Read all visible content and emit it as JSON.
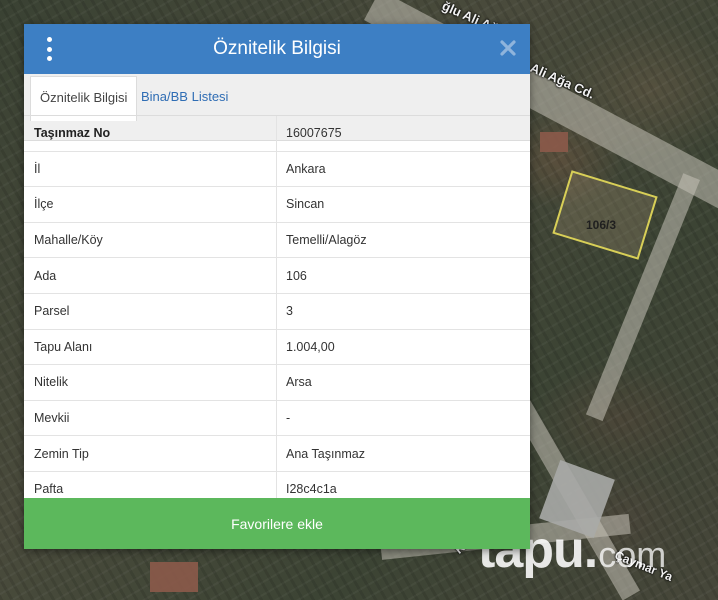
{
  "dialog": {
    "title": "Öznitelik Bilgisi",
    "tabs": [
      {
        "label": "Öznitelik Bilgisi",
        "active": true
      },
      {
        "label": "Bina/BB Listesi",
        "active": false
      }
    ],
    "rows": [
      {
        "key": "Taşınmaz No",
        "value": "16007675"
      },
      {
        "key": "İl",
        "value": "Ankara"
      },
      {
        "key": "İlçe",
        "value": "Sincan"
      },
      {
        "key": "Mahalle/Köy",
        "value": "Temelli/Alagöz"
      },
      {
        "key": "Ada",
        "value": "106"
      },
      {
        "key": "Parsel",
        "value": "3"
      },
      {
        "key": "Tapu Alanı",
        "value": "1.004,00"
      },
      {
        "key": "Nitelik",
        "value": "Arsa"
      },
      {
        "key": "Mevkii",
        "value": "-"
      },
      {
        "key": "Zemin Tip",
        "value": "Ana Taşınmaz"
      },
      {
        "key": "Pafta",
        "value": "I28c4c1a"
      }
    ],
    "favorite_button": "Favorilere ekle"
  },
  "map": {
    "street_top": "ğlu Ali Ağa Cd.",
    "street_mid": "Ali Ağa Cd.",
    "parcel_label": "106/3",
    "street_bottom_right": "Çaymar Ya",
    "street_bottom_left": "Koop."
  },
  "watermark": {
    "main": "tapu",
    "dot": ".",
    "sub": "com"
  },
  "colors": {
    "header": "#3d7fc4",
    "button": "#5cb85c",
    "tab_link": "#2f6db4",
    "parcel_outline": "#d8cf57"
  },
  "icons": {
    "menu": "vertical-dots-icon",
    "close": "close-x-icon"
  }
}
